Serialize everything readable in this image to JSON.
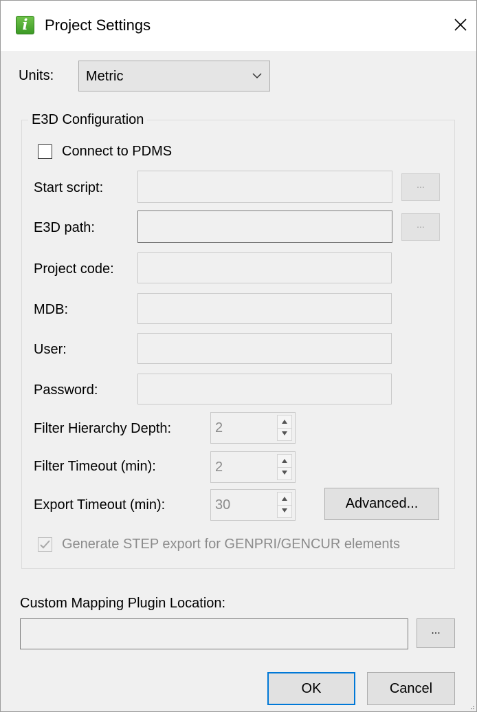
{
  "window": {
    "title": "Project Settings",
    "icon": "info-app-icon",
    "icon_glyph": "i"
  },
  "units": {
    "label": "Units:",
    "value": "Metric"
  },
  "e3d": {
    "group_title": "E3D Configuration",
    "connect_label": "Connect to PDMS",
    "connect_checked": false,
    "start_script_label": "Start script:",
    "start_script_value": "",
    "e3d_path_label": "E3D path:",
    "e3d_path_value": "",
    "browse_label": "...",
    "project_code_label": "Project code:",
    "mdb_label": "MDB:",
    "user_label": "User:",
    "password_label": "Password:",
    "filter_depth_label": "Filter Hierarchy Depth:",
    "filter_depth_value": "2",
    "filter_timeout_label": "Filter Timeout (min):",
    "filter_timeout_value": "2",
    "export_timeout_label": "Export Timeout (min):",
    "export_timeout_value": "30",
    "advanced_label": "Advanced...",
    "step_export_label": "Generate STEP export for GENPRI/GENCUR elements",
    "step_export_checked": true
  },
  "plugin": {
    "label": "Custom Mapping Plugin Location:",
    "value": "",
    "browse_label": "..."
  },
  "footer": {
    "ok_label": "OK",
    "cancel_label": "Cancel"
  },
  "colors": {
    "accent": "#0078d7",
    "app_icon": "#4aa82f",
    "disabled_text": "#8b8b8b"
  }
}
